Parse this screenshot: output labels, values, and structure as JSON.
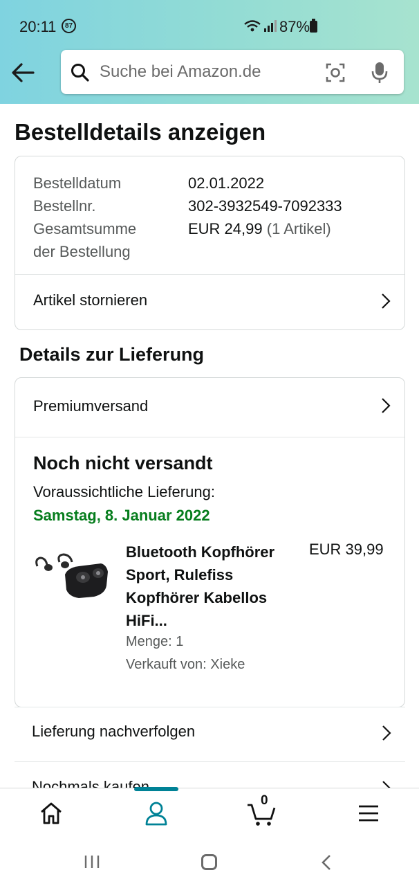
{
  "status_bar": {
    "time": "20:11",
    "notification_count": "87",
    "battery": "87%"
  },
  "search": {
    "placeholder": "Suche bei Amazon.de"
  },
  "page": {
    "title": "Bestelldetails anzeigen"
  },
  "order": {
    "date_label": "Bestelldatum",
    "date_value": "02.01.2022",
    "number_label": "Bestellnr.",
    "number_value": "302-3932549-7092333",
    "total_label": "Gesamtsumme der Bestellung",
    "total_value": "EUR 24,99",
    "total_items": "(1 Artikel)",
    "cancel_label": "Artikel stornieren"
  },
  "delivery": {
    "section_title": "Details zur Lieferung",
    "shipping_method": "Premiumversand",
    "status": "Noch nicht versandt",
    "expected_label": "Voraussichtliche Lieferung:",
    "expected_date": "Samstag, 8. Januar 2022",
    "date_color": "#067D1D"
  },
  "product": {
    "title": "Bluetooth Kopfhörer Sport, Rulefiss Kopfhörer Kabellos HiFi...",
    "price": "EUR 39,99",
    "quantity": "Menge: 1",
    "seller": "Verkauft von: Xieke"
  },
  "actions": {
    "track": "Lieferung nachverfolgen",
    "buy_again": "Nochmals kaufen"
  },
  "bottom_nav": {
    "items": [
      "home-icon",
      "account-icon",
      "cart-icon",
      "menu-icon"
    ],
    "active": "account-icon",
    "cart_count": "0",
    "accent": "#008296"
  }
}
